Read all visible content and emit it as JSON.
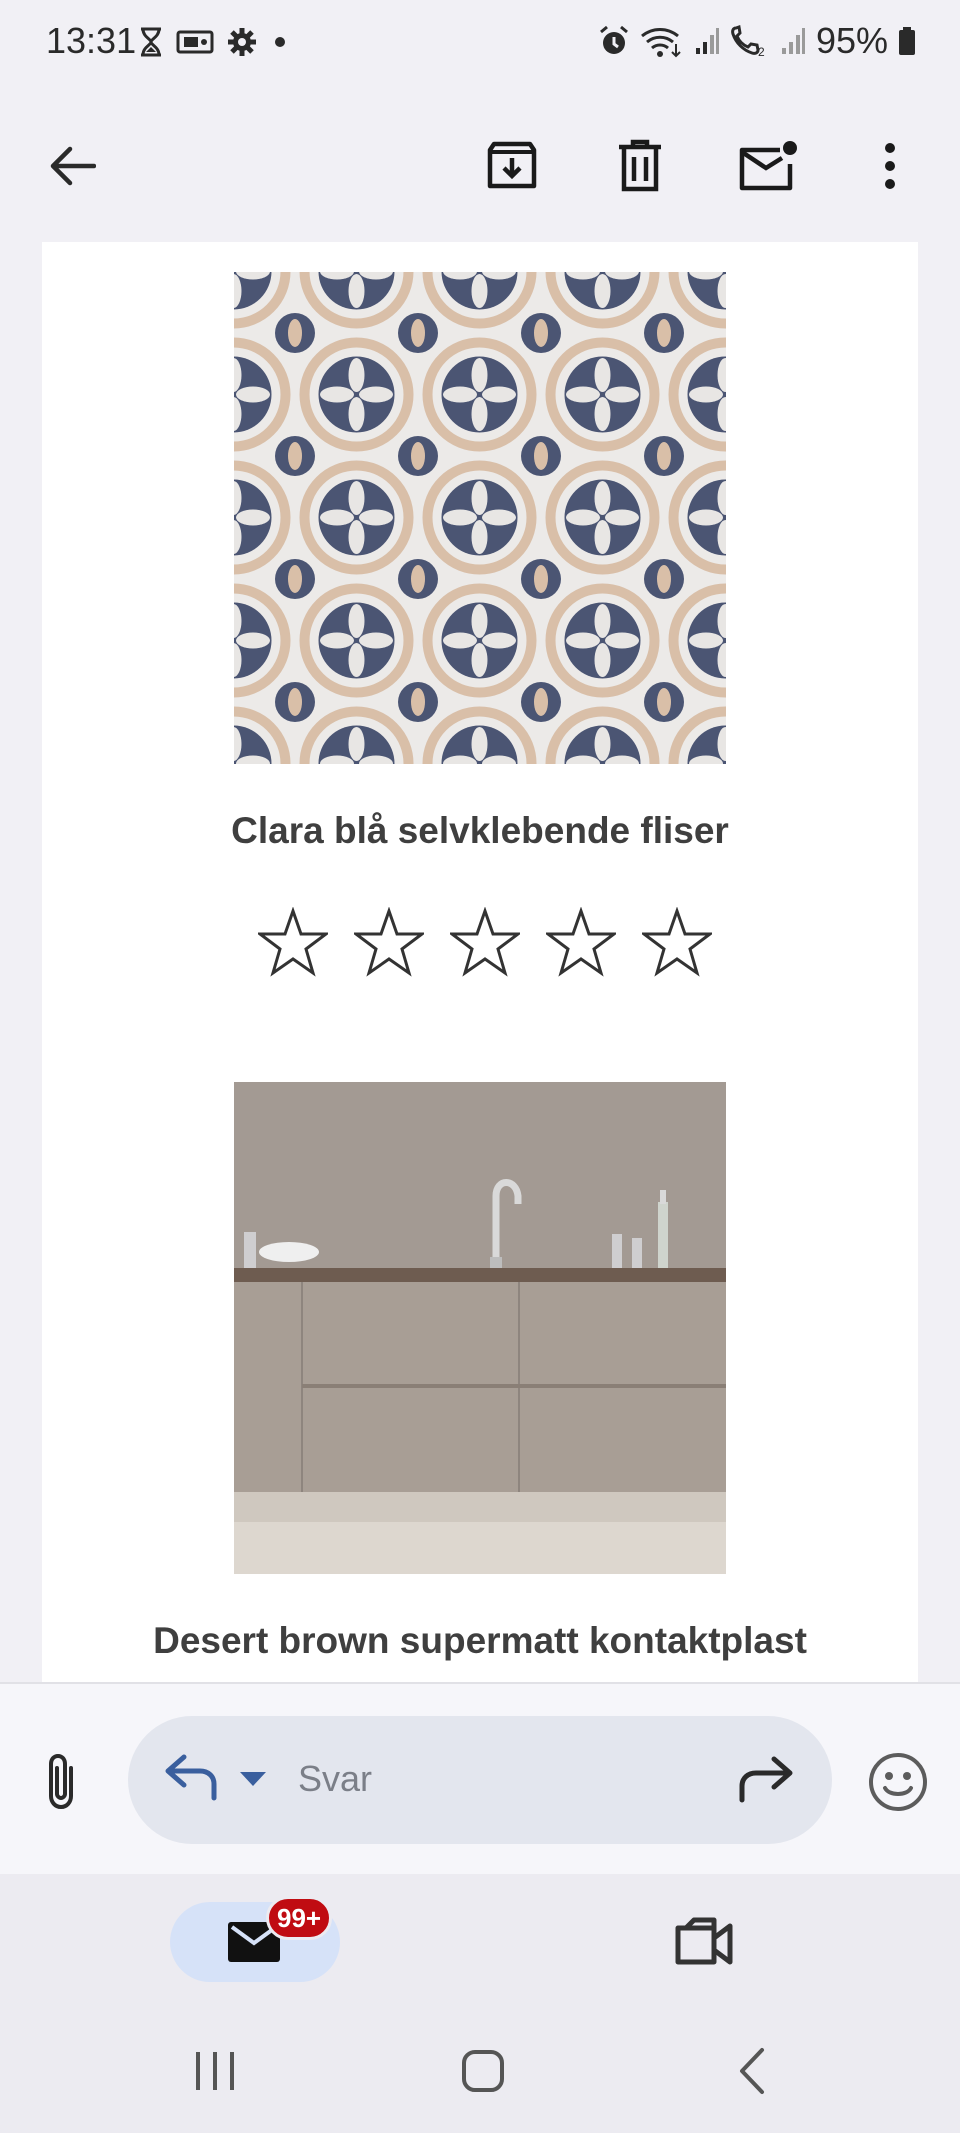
{
  "status_bar": {
    "time": "13:31",
    "left_icons": [
      "hourglass-icon",
      "ticket-icon",
      "gear-icon",
      "dot-icon"
    ],
    "right_icons": [
      "alarm-icon",
      "wifi-icon",
      "signal-icon",
      "volte-call-icon",
      "signal-icon"
    ],
    "battery": "95%"
  },
  "toolbar": {
    "back": "back-arrow-icon",
    "actions": [
      "archive-icon",
      "delete-icon",
      "mark-unread-icon",
      "more-vert-icon"
    ]
  },
  "email": {
    "products": [
      {
        "title": "Clara blå selvklebende fliser",
        "rating_stars": 5,
        "filled_stars": 0
      },
      {
        "title": "Desert brown supermatt kontaktplast"
      }
    ]
  },
  "reply_bar": {
    "placeholder": "Svar"
  },
  "bottom_nav": {
    "mail_badge": "99+"
  },
  "colors": {
    "accent_blue": "#3a5f9e",
    "badge_red": "#c00c12",
    "tile_navy": "#4b5573",
    "tile_beige": "#d9bfa8",
    "kitchen_taupe": "#a79e97"
  }
}
